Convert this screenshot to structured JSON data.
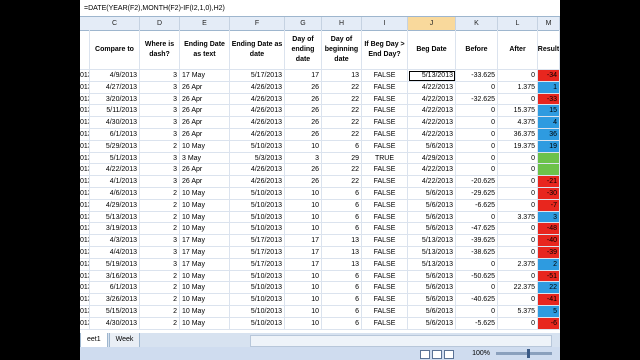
{
  "formula": "=DATE(YEAR(F2),MONTH(F2)-IF(I2,1,0),H2)",
  "columns": [
    {
      "letter": "C",
      "header": "Compare to"
    },
    {
      "letter": "D",
      "header": "Where is dash?"
    },
    {
      "letter": "E",
      "header": "Ending Date as text"
    },
    {
      "letter": "F",
      "header": "Ending Date as date"
    },
    {
      "letter": "G",
      "header": "Day of ending date"
    },
    {
      "letter": "H",
      "header": "Day of beginning date"
    },
    {
      "letter": "I",
      "header": "If Beg Day > End Day?"
    },
    {
      "letter": "J",
      "header": "Beg Date"
    },
    {
      "letter": "K",
      "header": "Before"
    },
    {
      "letter": "L",
      "header": "After"
    },
    {
      "letter": "M",
      "header": "Result"
    }
  ],
  "rows": [
    {
      "b": "013",
      "c": "4/9/2013",
      "d": "3",
      "e": "17 May",
      "f": "5/17/2013",
      "g": "17",
      "h": "13",
      "i": "FALSE",
      "j": "5/13/2013",
      "k": "-33.625",
      "l": "0",
      "m": "-34",
      "mc": "#e8261e"
    },
    {
      "b": "013",
      "c": "4/27/2013",
      "d": "3",
      "e": "26 Apr",
      "f": "4/26/2013",
      "g": "26",
      "h": "22",
      "i": "FALSE",
      "j": "4/22/2013",
      "k": "0",
      "l": "1.375",
      "m": "1",
      "mc": "#2e9be0"
    },
    {
      "b": "013",
      "c": "3/20/2013",
      "d": "3",
      "e": "26 Apr",
      "f": "4/26/2013",
      "g": "26",
      "h": "22",
      "i": "FALSE",
      "j": "4/22/2013",
      "k": "-32.625",
      "l": "0",
      "m": "-33",
      "mc": "#e8261e"
    },
    {
      "b": "013",
      "c": "5/11/2013",
      "d": "3",
      "e": "26 Apr",
      "f": "4/26/2013",
      "g": "26",
      "h": "22",
      "i": "FALSE",
      "j": "4/22/2013",
      "k": "0",
      "l": "15.375",
      "m": "15",
      "mc": "#2e9be0"
    },
    {
      "b": "013",
      "c": "4/30/2013",
      "d": "3",
      "e": "26 Apr",
      "f": "4/26/2013",
      "g": "26",
      "h": "22",
      "i": "FALSE",
      "j": "4/22/2013",
      "k": "0",
      "l": "4.375",
      "m": "4",
      "mc": "#2e9be0"
    },
    {
      "b": "013",
      "c": "6/1/2013",
      "d": "3",
      "e": "26 Apr",
      "f": "4/26/2013",
      "g": "26",
      "h": "22",
      "i": "FALSE",
      "j": "4/22/2013",
      "k": "0",
      "l": "36.375",
      "m": "36",
      "mc": "#2e9be0"
    },
    {
      "b": "013",
      "c": "5/29/2013",
      "d": "2",
      "e": "10 May",
      "f": "5/10/2013",
      "g": "10",
      "h": "6",
      "i": "FALSE",
      "j": "5/6/2013",
      "k": "0",
      "l": "19.375",
      "m": "19",
      "mc": "#2e9be0"
    },
    {
      "b": "013",
      "c": "5/1/2013",
      "d": "3",
      "e": "3 May",
      "f": "5/3/2013",
      "g": "3",
      "h": "29",
      "i": "TRUE",
      "j": "4/29/2013",
      "k": "0",
      "l": "0",
      "m": "",
      "mc": "#6cc24a"
    },
    {
      "b": "013",
      "c": "4/22/2013",
      "d": "3",
      "e": "26 Apr",
      "f": "4/26/2013",
      "g": "26",
      "h": "22",
      "i": "FALSE",
      "j": "4/22/2013",
      "k": "0",
      "l": "0",
      "m": "",
      "mc": "#6cc24a"
    },
    {
      "b": "013",
      "c": "4/1/2013",
      "d": "3",
      "e": "26 Apr",
      "f": "4/26/2013",
      "g": "26",
      "h": "22",
      "i": "FALSE",
      "j": "4/22/2013",
      "k": "-20.625",
      "l": "0",
      "m": "-21",
      "mc": "#e8261e"
    },
    {
      "b": "013",
      "c": "4/6/2013",
      "d": "2",
      "e": "10 May",
      "f": "5/10/2013",
      "g": "10",
      "h": "6",
      "i": "FALSE",
      "j": "5/6/2013",
      "k": "-29.625",
      "l": "0",
      "m": "-30",
      "mc": "#e8261e"
    },
    {
      "b": "013",
      "c": "4/29/2013",
      "d": "2",
      "e": "10 May",
      "f": "5/10/2013",
      "g": "10",
      "h": "6",
      "i": "FALSE",
      "j": "5/6/2013",
      "k": "-6.625",
      "l": "0",
      "m": "-7",
      "mc": "#e8261e"
    },
    {
      "b": "013",
      "c": "5/13/2013",
      "d": "2",
      "e": "10 May",
      "f": "5/10/2013",
      "g": "10",
      "h": "6",
      "i": "FALSE",
      "j": "5/6/2013",
      "k": "0",
      "l": "3.375",
      "m": "3",
      "mc": "#2e9be0"
    },
    {
      "b": "013",
      "c": "3/19/2013",
      "d": "2",
      "e": "10 May",
      "f": "5/10/2013",
      "g": "10",
      "h": "6",
      "i": "FALSE",
      "j": "5/6/2013",
      "k": "-47.625",
      "l": "0",
      "m": "-48",
      "mc": "#e8261e"
    },
    {
      "b": "013",
      "c": "4/3/2013",
      "d": "3",
      "e": "17 May",
      "f": "5/17/2013",
      "g": "17",
      "h": "13",
      "i": "FALSE",
      "j": "5/13/2013",
      "k": "-39.625",
      "l": "0",
      "m": "-40",
      "mc": "#e8261e"
    },
    {
      "b": "013",
      "c": "4/4/2013",
      "d": "3",
      "e": "17 May",
      "f": "5/17/2013",
      "g": "17",
      "h": "13",
      "i": "FALSE",
      "j": "5/13/2013",
      "k": "-38.625",
      "l": "0",
      "m": "-39",
      "mc": "#e8261e"
    },
    {
      "b": "013",
      "c": "5/19/2013",
      "d": "3",
      "e": "17 May",
      "f": "5/17/2013",
      "g": "17",
      "h": "13",
      "i": "FALSE",
      "j": "5/13/2013",
      "k": "0",
      "l": "2.375",
      "m": "2",
      "mc": "#2e9be0"
    },
    {
      "b": "013",
      "c": "3/16/2013",
      "d": "2",
      "e": "10 May",
      "f": "5/10/2013",
      "g": "10",
      "h": "6",
      "i": "FALSE",
      "j": "5/6/2013",
      "k": "-50.625",
      "l": "0",
      "m": "-51",
      "mc": "#e8261e"
    },
    {
      "b": "013",
      "c": "6/1/2013",
      "d": "2",
      "e": "10 May",
      "f": "5/10/2013",
      "g": "10",
      "h": "6",
      "i": "FALSE",
      "j": "5/6/2013",
      "k": "0",
      "l": "22.375",
      "m": "22",
      "mc": "#2e9be0"
    },
    {
      "b": "013",
      "c": "3/26/2013",
      "d": "2",
      "e": "10 May",
      "f": "5/10/2013",
      "g": "10",
      "h": "6",
      "i": "FALSE",
      "j": "5/6/2013",
      "k": "-40.625",
      "l": "0",
      "m": "-41",
      "mc": "#e8261e"
    },
    {
      "b": "013",
      "c": "5/15/2013",
      "d": "2",
      "e": "10 May",
      "f": "5/10/2013",
      "g": "10",
      "h": "6",
      "i": "FALSE",
      "j": "5/6/2013",
      "k": "0",
      "l": "5.375",
      "m": "5",
      "mc": "#2e9be0"
    },
    {
      "b": "013",
      "c": "4/30/2013",
      "d": "2",
      "e": "10 May",
      "f": "5/10/2013",
      "g": "10",
      "h": "6",
      "i": "FALSE",
      "j": "5/6/2013",
      "k": "-5.625",
      "l": "0",
      "m": "-6",
      "mc": "#e8261e"
    }
  ],
  "sheet_tabs": [
    "eet1",
    "Week"
  ],
  "zoom": "100%"
}
